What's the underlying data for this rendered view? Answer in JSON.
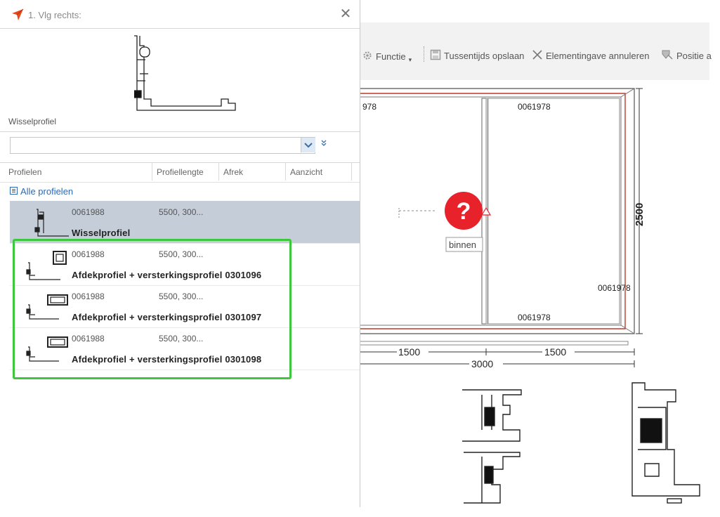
{
  "dialog": {
    "title": "1. Vlg rechts:",
    "close_glyph": "✕",
    "preview_label": "Wisselprofiel",
    "expand_glyph": "»"
  },
  "grid": {
    "columns": [
      "Profielen",
      "Profiellengte",
      "Afrek",
      "Aanzicht"
    ],
    "group_label": "Alle profielen",
    "rows": [
      {
        "code": "0061988",
        "length": "5500,  300...",
        "name": "Wisselprofiel",
        "selected": true
      },
      {
        "code": "0061988",
        "length": "5500,  300...",
        "name": "Afdekprofiel + versterkingsprofiel 0301096",
        "selected": false
      },
      {
        "code": "0061988",
        "length": "5500,  300...",
        "name": "Afdekprofiel + versterkingsprofiel 0301097",
        "selected": false
      },
      {
        "code": "0061988",
        "length": "5500,  300...",
        "name": "Afdekprofiel + versterkingsprofiel 0301098",
        "selected": false
      }
    ]
  },
  "toolbar": {
    "functie": "Functie",
    "save": "Tussentijds opslaan",
    "cancel": "Elementingave annuleren",
    "position": "Positie a"
  },
  "drawing": {
    "label_top_left": "978",
    "label_top_right": "0061978",
    "label_right": "0061978",
    "label_bottom": "0061978",
    "dim_height": "2500",
    "dim_left": "1500",
    "dim_right": "1500",
    "dim_total": "3000",
    "warning_glyph": "?",
    "binnen_label": "binnen"
  },
  "colors": {
    "highlight": "#3fc63f",
    "selected_row": "#c5cdd8",
    "warning": "#e8222b",
    "link": "#2d6ab0",
    "frame_line": "#c0392b"
  },
  "icons": {
    "app": "arrow-cursor-icon",
    "close": "close-icon",
    "dropdown": "chevron-down-icon",
    "expand": "double-chevron-icon",
    "tree": "tree-collapse-icon",
    "functie": "gear-icon",
    "save": "save-icon",
    "cancel": "close-x-icon",
    "position": "position-icon",
    "warning": "question-warning-icon"
  }
}
